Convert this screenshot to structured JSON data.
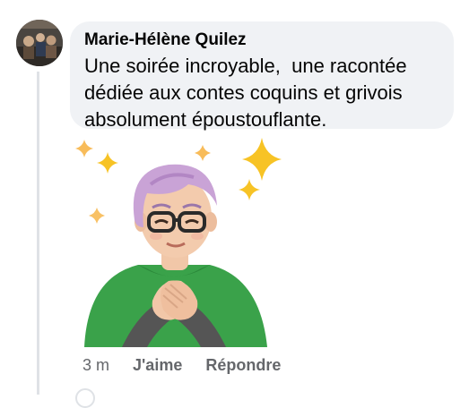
{
  "comment": {
    "author": "Marie-Hélène Quilez",
    "text": "Une soirée incroyable,  une racontée\ndédiée aux contes coquins et grivois\nabsolument époustouflante.",
    "timestamp": "3 m",
    "like_label": "J'aime",
    "reply_label": "Répondre",
    "sticker": "grateful-avatar-sticker"
  },
  "colors": {
    "bubble": "#f0f2f5",
    "meta_text": "#65676b",
    "text": "#050505",
    "sparkle": "#f7c325",
    "sweater": "#3aa24a",
    "hair": "#c9a3d6"
  }
}
